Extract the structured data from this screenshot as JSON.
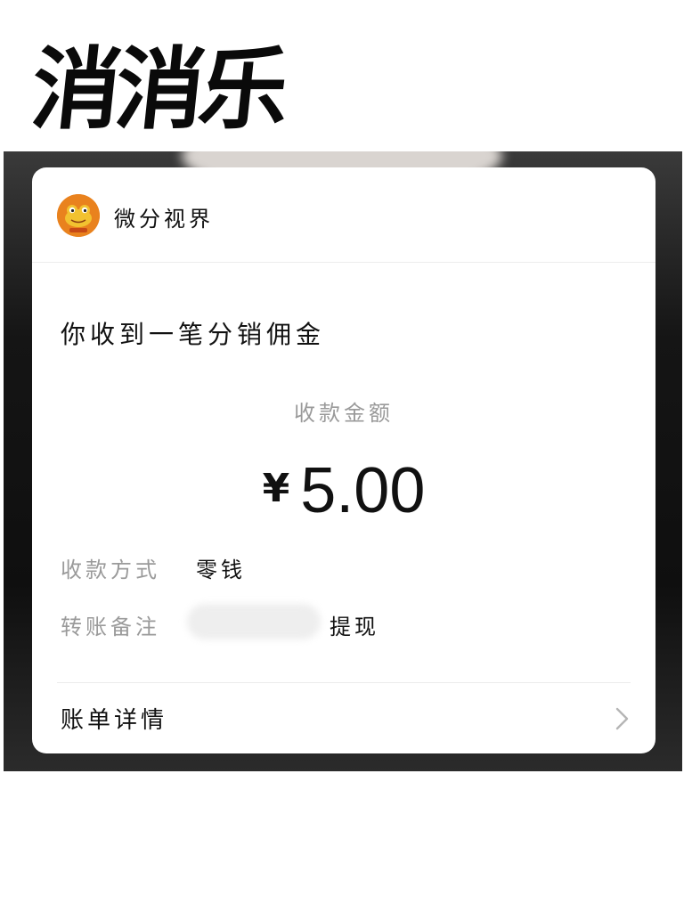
{
  "headline": "消消乐",
  "card": {
    "brand_name": "微分视界",
    "avatar_text": "",
    "notice_title": "你收到一笔分销佣金",
    "amount_label": "收款金额",
    "currency": "¥",
    "amount": "5.00",
    "payment_method": {
      "label": "收款方式",
      "value": "零钱"
    },
    "transfer_note": {
      "label": "转账备注",
      "value": "提现"
    },
    "bill_details_label": "账单详情"
  },
  "colors": {
    "accent_avatar": "#e9821e",
    "muted_text": "#9a9a9a",
    "primary_text": "#111111"
  },
  "icons": {
    "avatar": "frog-avatar-icon",
    "chevron": "chevron-right-icon"
  }
}
